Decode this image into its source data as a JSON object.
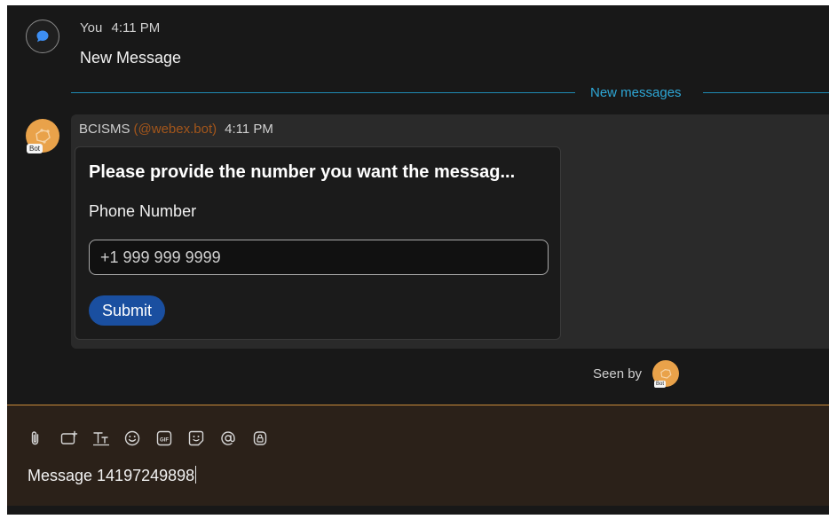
{
  "self_message": {
    "sender": "You",
    "time": "4:11 PM",
    "text": "New Message"
  },
  "divider": {
    "label": "New messages"
  },
  "bot_message": {
    "sender": "BCISMS",
    "handle": "(@webex.bot)",
    "time": "4:11 PM",
    "avatar_badge": "Bot",
    "card": {
      "title": "Please provide the number you want the messag...",
      "field_label": "Phone Number",
      "input_placeholder": "+1 999 999 9999",
      "submit_label": "Submit"
    }
  },
  "seen_by": {
    "label": "Seen by",
    "avatar_badge": "Bot"
  },
  "composer": {
    "toolbar_icons": [
      "attach-icon",
      "screenshot-icon",
      "text-format-icon",
      "emoji-icon",
      "gif-icon",
      "sticker-icon",
      "mention-icon",
      "secure-icon"
    ],
    "text": "Message 14197249898"
  },
  "colors": {
    "background": "#181818",
    "accent_blue": "#2ea7d6",
    "button_blue": "#1a4fa0",
    "bot_avatar": "#e9a24a",
    "composer_bg": "#2b2119",
    "handle_color": "#a3561b"
  }
}
